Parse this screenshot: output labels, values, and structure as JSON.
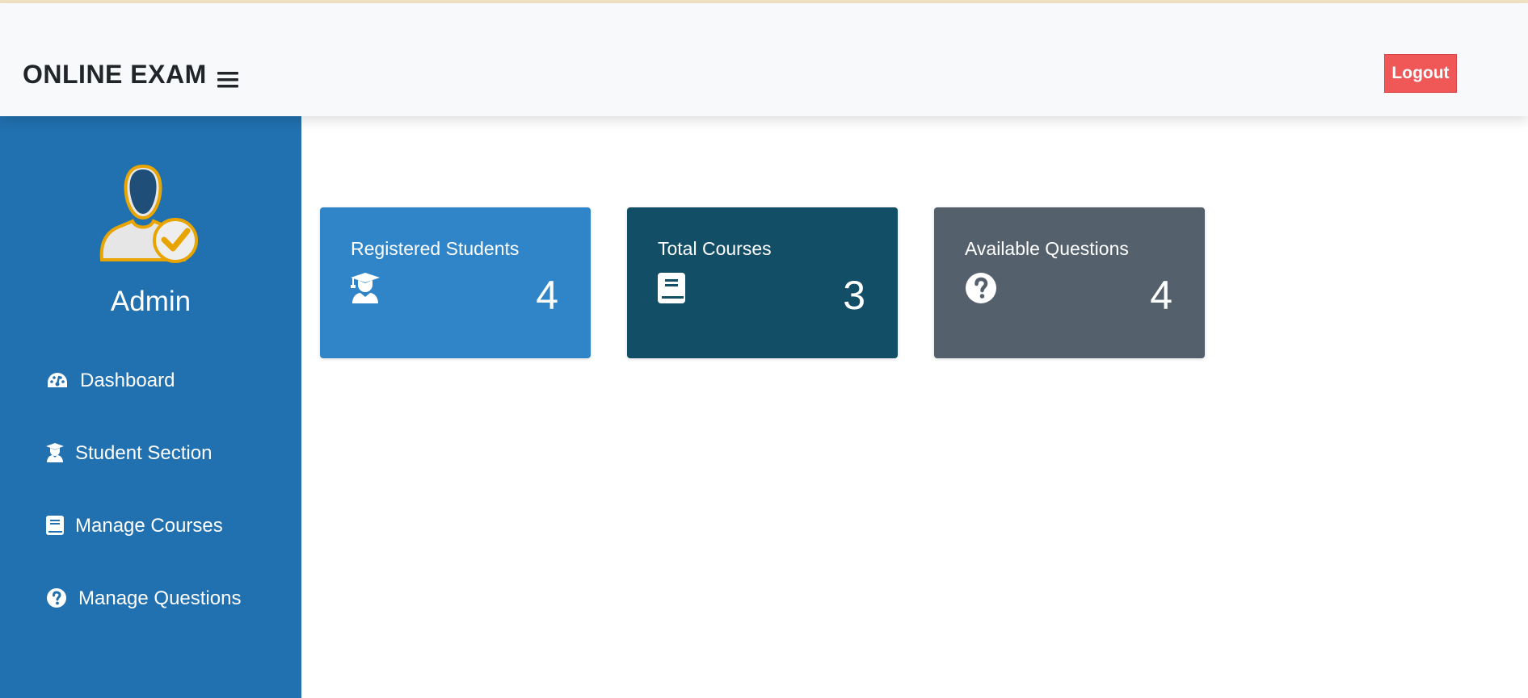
{
  "header": {
    "brand": "ONLINE EXAM",
    "menu_icon": "hamburger-menu-icon",
    "logout_label": "Logout",
    "logout_color": "#f05757"
  },
  "sidebar": {
    "background": "#2170af",
    "user_name": "Admin",
    "avatar_icon": "admin-user-check-icon",
    "items": [
      {
        "label": "Dashboard",
        "icon": "dashboard-gauge-icon"
      },
      {
        "label": "Student Section",
        "icon": "graduate-student-icon"
      },
      {
        "label": "Manage Courses",
        "icon": "book-icon"
      },
      {
        "label": "Manage Questions",
        "icon": "question-circle-icon"
      }
    ]
  },
  "main": {
    "cards": [
      {
        "label": "Registered Students",
        "value": "4",
        "icon": "graduate-student-icon",
        "color": "#3085c9"
      },
      {
        "label": "Total Courses",
        "value": "3",
        "icon": "book-icon",
        "color": "#124e66"
      },
      {
        "label": "Available Questions",
        "value": "4",
        "icon": "question-circle-icon",
        "color": "#55606d"
      }
    ]
  }
}
